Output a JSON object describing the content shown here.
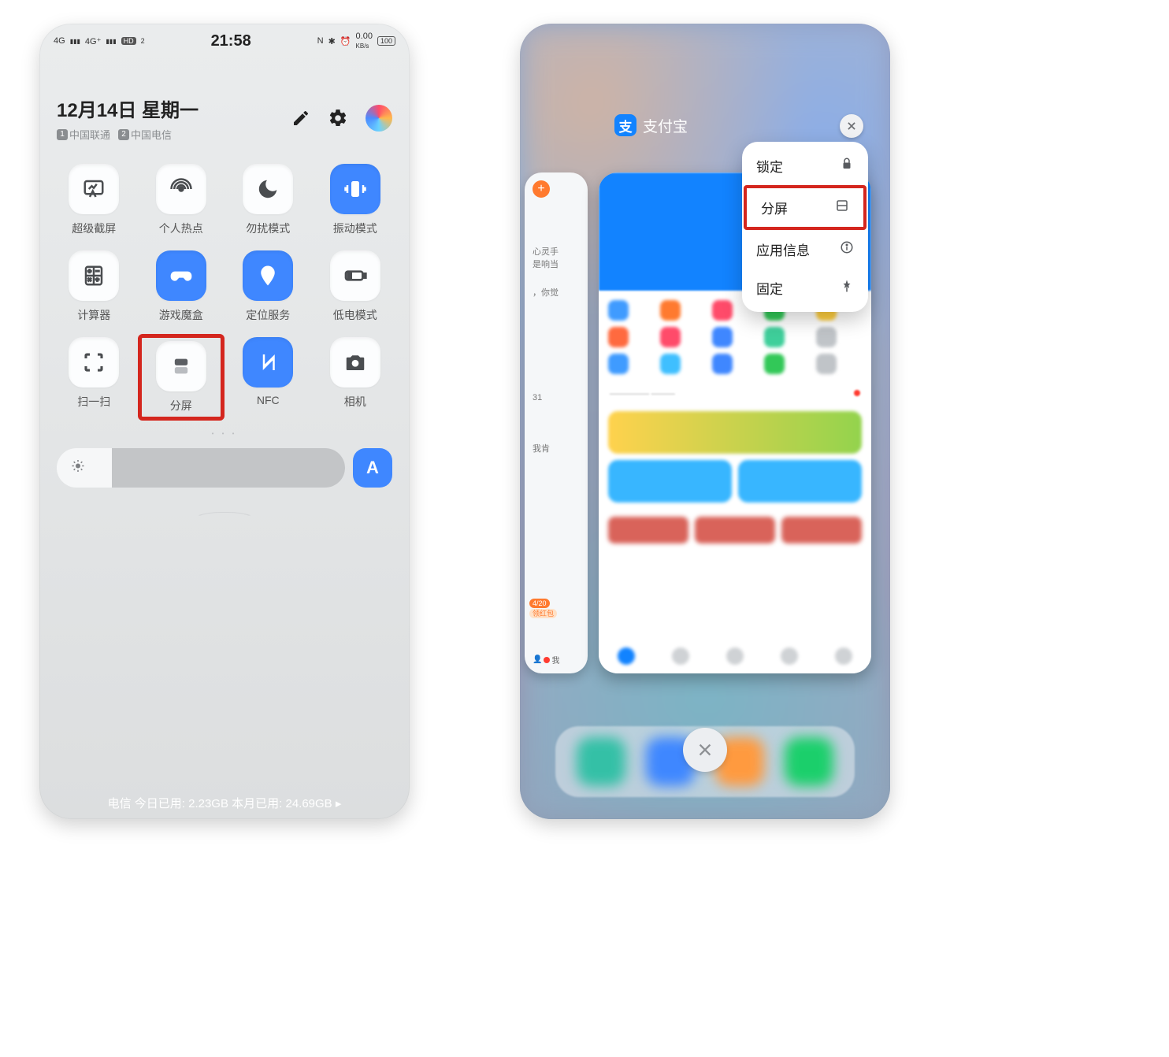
{
  "left": {
    "status": {
      "signal1": "4G",
      "signal2": "4G⁺",
      "hd": "HD",
      "sim2": "2",
      "clock": "21:58",
      "right": {
        "n": "N",
        "bt": "✱",
        "alarm": "⏰",
        "speed_val": "0.00",
        "speed_unit": "KB/s",
        "battery": "100"
      }
    },
    "header": {
      "date": "12月14日 星期一",
      "carrier1": "中国联通",
      "carrier2": "中国电信"
    },
    "tiles": [
      {
        "id": "super-screenshot",
        "label": "超级截屏",
        "active": false
      },
      {
        "id": "hotspot",
        "label": "个人热点",
        "active": false
      },
      {
        "id": "dnd",
        "label": "勿扰模式",
        "active": false
      },
      {
        "id": "vibrate",
        "label": "振动模式",
        "active": true
      },
      {
        "id": "calculator",
        "label": "计算器",
        "active": false
      },
      {
        "id": "game-box",
        "label": "游戏魔盒",
        "active": true
      },
      {
        "id": "location",
        "label": "定位服务",
        "active": true
      },
      {
        "id": "low-power",
        "label": "低电模式",
        "active": false
      },
      {
        "id": "scan",
        "label": "扫一扫",
        "active": false
      },
      {
        "id": "split-screen",
        "label": "分屏",
        "active": false,
        "highlighted": true
      },
      {
        "id": "nfc",
        "label": "NFC",
        "active": true
      },
      {
        "id": "camera",
        "label": "相机",
        "active": false
      }
    ],
    "auto_brightness_label": "A",
    "footer": "电信  今日已用: 2.23GB   本月已用: 24.69GB ▸"
  },
  "right": {
    "app_title": "支付宝",
    "context_menu": [
      {
        "id": "lock",
        "label": "锁定",
        "icon": "lock"
      },
      {
        "id": "split",
        "label": "分屏",
        "icon": "split",
        "highlighted": true
      },
      {
        "id": "app-info",
        "label": "应用信息",
        "icon": "info"
      },
      {
        "id": "pin",
        "label": "固定",
        "icon": "pin"
      }
    ],
    "close_all_icon": "×",
    "back_card_snippets": {
      "line1": "心灵手",
      "line2": "是响当",
      "line3": "，你觉",
      "line4": "31",
      "line5": "我肯",
      "tag": "4/20",
      "tag2": "领红包",
      "me": "我"
    }
  }
}
